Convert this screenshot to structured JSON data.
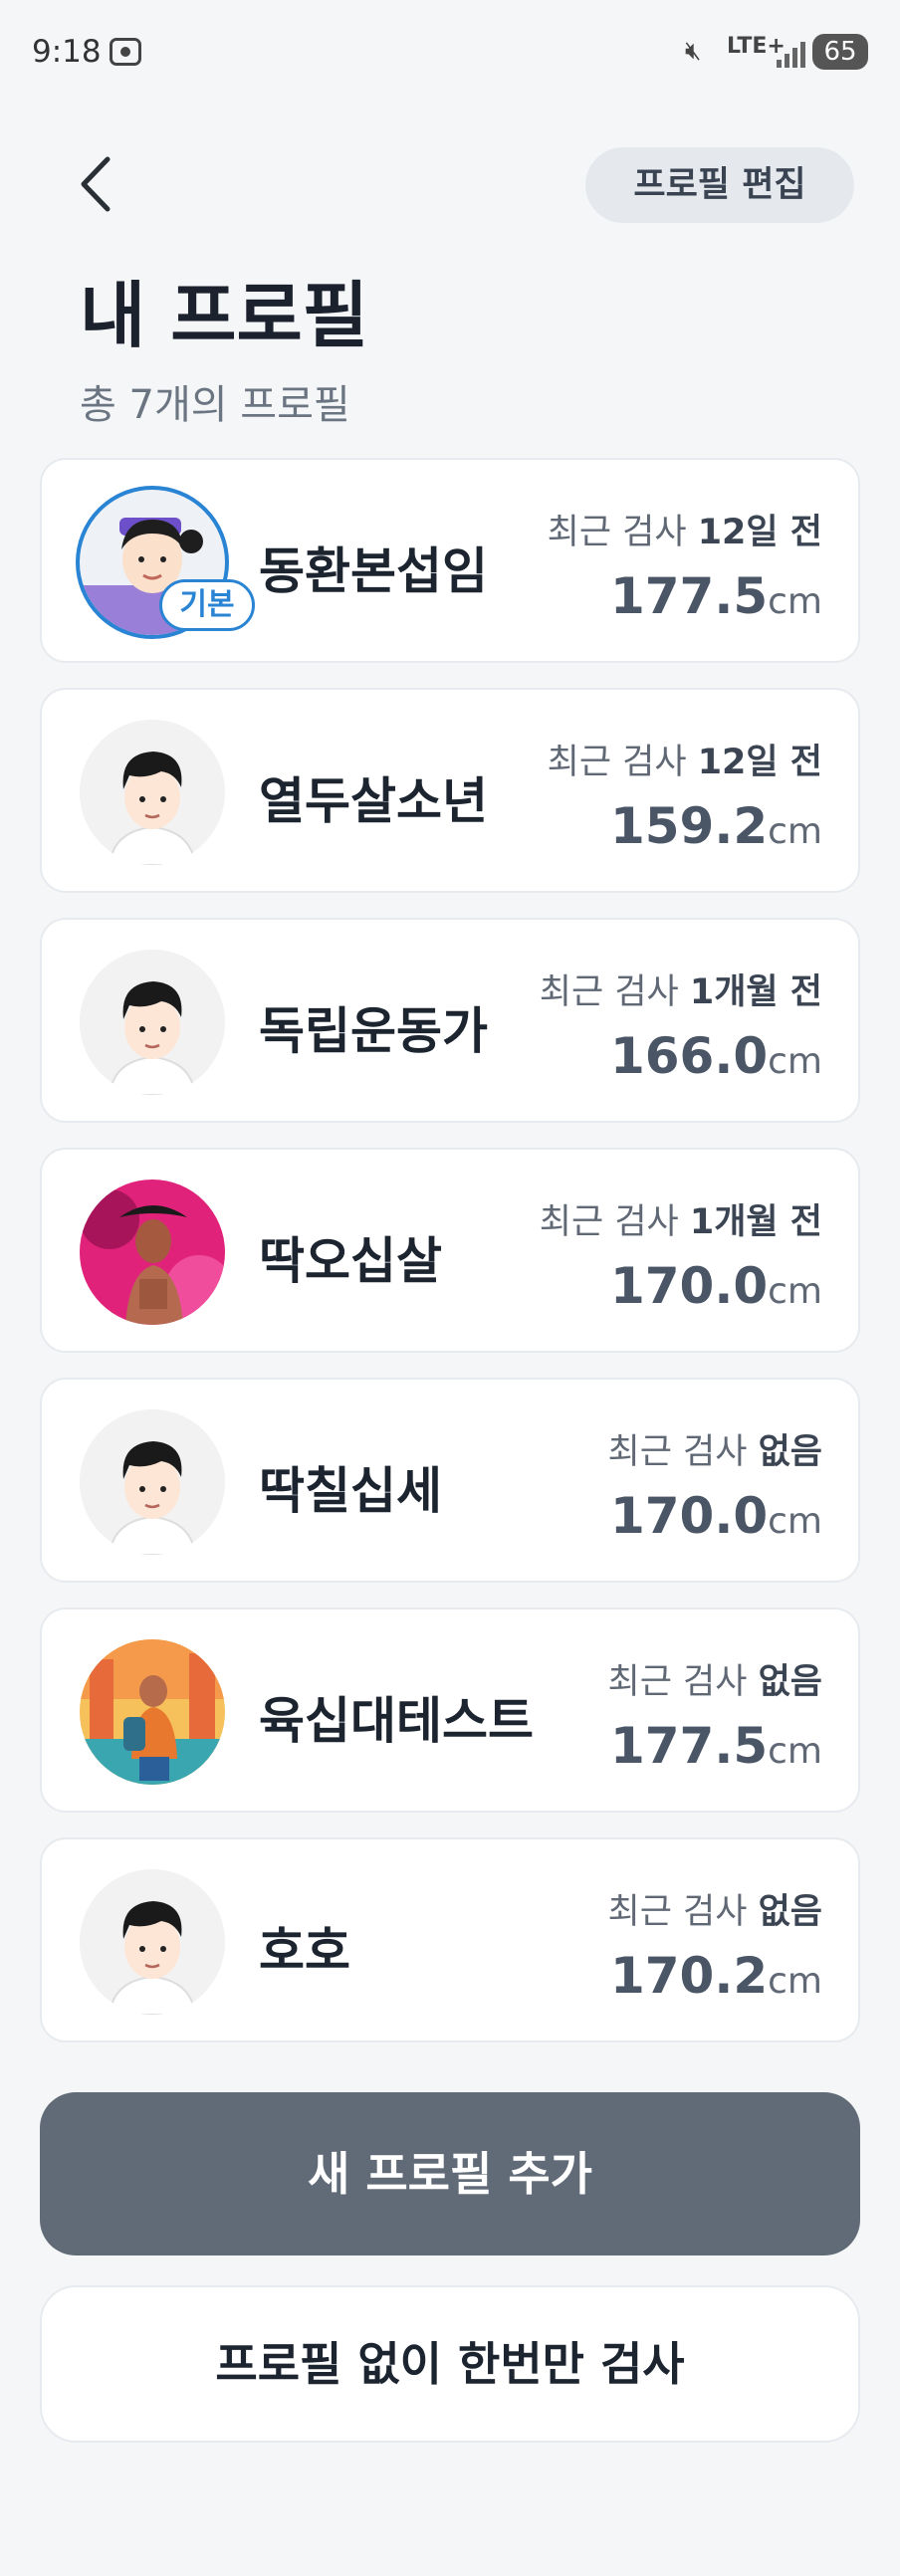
{
  "status_bar": {
    "time": "9:18",
    "network": "LTE+",
    "battery": "65",
    "icons": [
      "screenshot-icon",
      "mute-icon",
      "signal-icon",
      "battery-icon"
    ]
  },
  "header": {
    "back_icon": "chevron-left-icon",
    "edit_label": "프로필 편집",
    "title": "내 프로필",
    "subtitle": "총 7개의 프로필"
  },
  "profiles": [
    {
      "name": "동환본섭임",
      "recent_prefix": "최근 검사 ",
      "recent_value": "12일 전",
      "height": "177.5",
      "unit": "cm",
      "is_default": true,
      "default_label": "기본",
      "avatar": "cartoon-girl-avatar"
    },
    {
      "name": "열두살소년",
      "recent_prefix": "최근 검사 ",
      "recent_value": "12일 전",
      "height": "159.2",
      "unit": "cm",
      "avatar": "cartoon-boy-avatar"
    },
    {
      "name": "독립운동가",
      "recent_prefix": "최근 검사 ",
      "recent_value": "1개월 전",
      "height": "166.0",
      "unit": "cm",
      "avatar": "cartoon-boy-avatar"
    },
    {
      "name": "딱오십살",
      "recent_prefix": "최근 검사 ",
      "recent_value": "1개월 전",
      "height": "170.0",
      "unit": "cm",
      "avatar": "photo-pink-avatar"
    },
    {
      "name": "딱칠십세",
      "recent_prefix": "최근 검사 ",
      "recent_value": "없음",
      "height": "170.0",
      "unit": "cm",
      "avatar": "cartoon-boy-avatar"
    },
    {
      "name": "육십대테스트",
      "recent_prefix": "최근 검사 ",
      "recent_value": "없음",
      "height": "177.5",
      "unit": "cm",
      "avatar": "illustration-traveler-avatar"
    },
    {
      "name": "호호",
      "recent_prefix": "최근 검사 ",
      "recent_value": "없음",
      "height": "170.2",
      "unit": "cm",
      "avatar": "cartoon-boy-avatar"
    }
  ],
  "actions": {
    "add_label": "새 프로필 추가",
    "once_label": "프로필 없이 한번만 검사"
  },
  "colors": {
    "background": "#f4f6f8",
    "accent_blue": "#2a84d4",
    "primary_button": "#616b78"
  }
}
